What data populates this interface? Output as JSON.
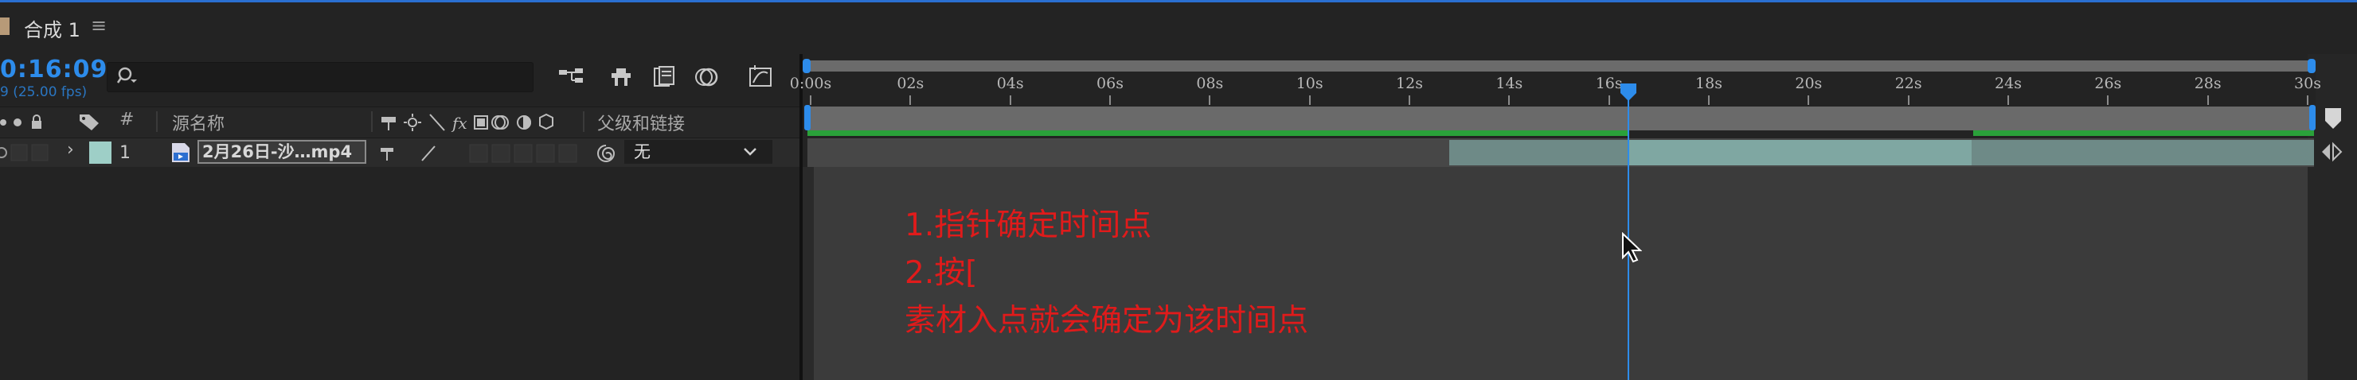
{
  "composition": {
    "tab_title": "合成 1",
    "menu_glyph": "≡"
  },
  "controls": {
    "timecode": "0:16:09",
    "fps": "9 (25.00 fps)",
    "search_placeholder": ""
  },
  "columns": {
    "number": "#",
    "source_name": "源名称",
    "parent_link": "父级和链接"
  },
  "layer": {
    "number": "1",
    "name": "2月26日-沙…mp4",
    "parent_value": "无",
    "label_color": "#9ecfc7"
  },
  "timeline": {
    "ticks": [
      "0:00s",
      "02s",
      "04s",
      "06s",
      "08s",
      "10s",
      "12s",
      "14s",
      "16s",
      "18s",
      "20s",
      "22s",
      "24s",
      "26s",
      "28s",
      "30s"
    ],
    "playhead_time_s": 16.36,
    "clip_in_point_s": 16.36,
    "clip_highlight_end_s": 23.3,
    "accent_color": "#2d8ceb"
  },
  "annotation": {
    "line1": "1.指针确定时间点",
    "line2": "2.按[",
    "line3": "素材入点就会确定为该时间点"
  }
}
